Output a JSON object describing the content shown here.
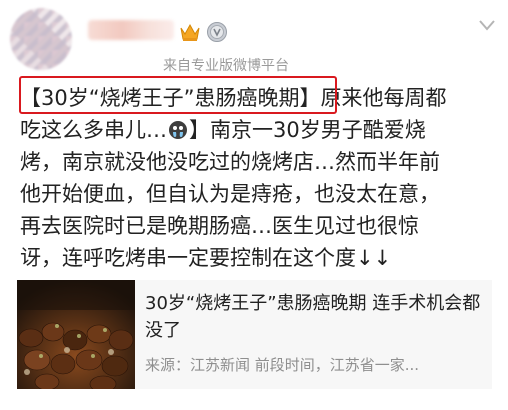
{
  "post": {
    "source": "来自专业版微博平台",
    "lines": [
      "【30岁“烧烤王子”患肠癌晚期】原来他每周都",
      "吃这么多串儿…",
      "】南京一30岁男子酷爱烧",
      "烤，南京就没他没吃过的烧烤店…然而半年前",
      "他开始便血，但自认为是痔疮，也没太在意，",
      "再去医院时已是晚期肠癌…医生见过也很惊",
      "讶，连呼吃烤串一定要控制在这个度↓↓"
    ]
  },
  "card": {
    "title": "30岁“烧烤王子”患肠癌晚期 连手术机会都没了",
    "source": "来源：江苏新闻 前段时间，江苏省一家..."
  },
  "icons": {
    "crown": "crown-icon",
    "level": "level-badge-icon",
    "menu": "chevron-down-icon",
    "emoji": "crying-face-icon"
  },
  "colors": {
    "highlight": "#d9191f",
    "text": "#222222",
    "muted": "#9a9a9a",
    "card_bg": "#f7f7f7"
  }
}
